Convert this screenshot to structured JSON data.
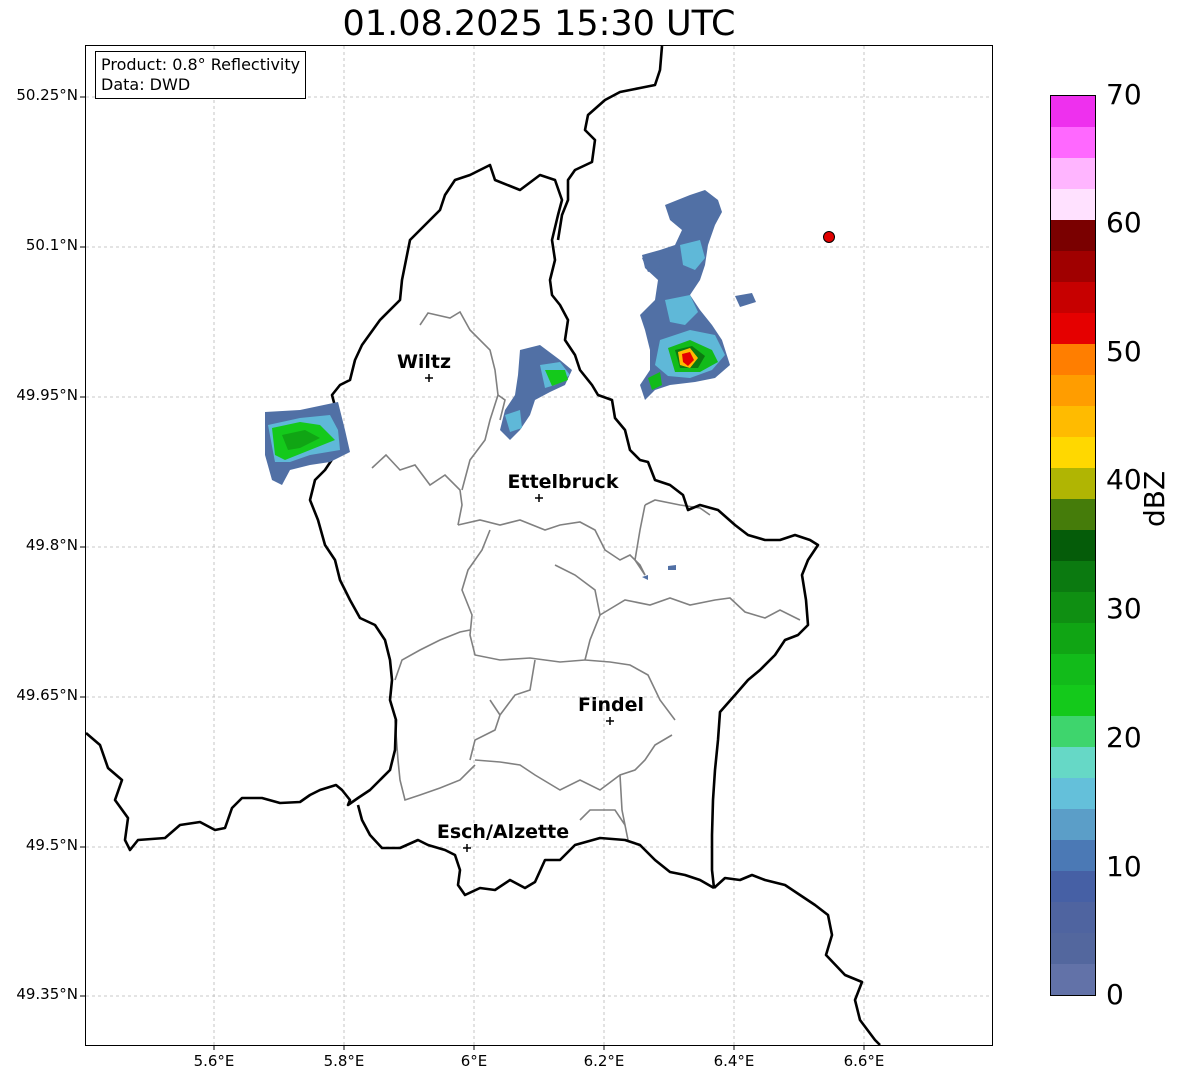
{
  "title": "01.08.2025 15:30 UTC",
  "info": {
    "product": "Product: 0.8° Reflectivity",
    "source": "Data: DWD"
  },
  "axes": {
    "lat_ticks": [
      "50.25°N",
      "50.1°N",
      "49.95°N",
      "49.8°N",
      "49.65°N",
      "49.5°N",
      "49.35°N"
    ],
    "lon_ticks": [
      "5.6°E",
      "5.8°E",
      "6°E",
      "6.2°E",
      "6.4°E",
      "6.6°E"
    ]
  },
  "cities": [
    {
      "name": "Wiltz"
    },
    {
      "name": "Ettelbruck"
    },
    {
      "name": "Findel"
    },
    {
      "name": "Esch/Alzette"
    }
  ],
  "colorbar": {
    "unit": "dBZ",
    "ticks": [
      "0",
      "10",
      "20",
      "30",
      "40",
      "50",
      "60",
      "70"
    ],
    "colors": [
      "#6272a8",
      "#53679e",
      "#4f64a0",
      "#4660a5",
      "#4b79b5",
      "#5b9ec8",
      "#64c0da",
      "#66d8c6",
      "#3ed56d",
      "#14c91b",
      "#12bb1a",
      "#10a514",
      "#0f8f12",
      "#0b7a10",
      "#055c09",
      "#457c0a",
      "#b0b503",
      "#ffd800",
      "#ffbb00",
      "#ff9d00",
      "#ff7e00",
      "#e50000",
      "#c70000",
      "#a00000",
      "#7a0000",
      "#ffe1ff",
      "#ffb5ff",
      "#ff68ff",
      "#ee30ee"
    ],
    "color_important": {
      "map_marker": "#e00000",
      "border": "#000000",
      "cantons": "#808080"
    }
  }
}
